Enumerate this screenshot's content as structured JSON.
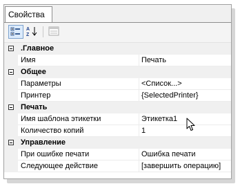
{
  "panel": {
    "tab_label": "Свойства",
    "toolbar": {
      "categorized_icon": "categorized-view-icon",
      "alphabetical_icon": "alphabetical-sort-icon",
      "property_pages_icon": "property-pages-icon"
    },
    "categories": [
      {
        "label": ".Главное",
        "properties": [
          {
            "name": "Имя",
            "value": "Печать"
          }
        ]
      },
      {
        "label": "Общее",
        "properties": [
          {
            "name": "Параметры",
            "value": "<Список...>"
          },
          {
            "name": "Принтер",
            "value": "{SelectedPrinter}"
          }
        ]
      },
      {
        "label": "Печать",
        "properties": [
          {
            "name": "Имя шаблона этикетки",
            "value": "Этикетка1"
          },
          {
            "name": "Количество копий",
            "value": "1"
          }
        ]
      },
      {
        "label": "Управление",
        "properties": [
          {
            "name": "При ошибке печати",
            "value": "Ошибка печати"
          },
          {
            "name": "Следующее действие",
            "value": "[завершить операцию]"
          }
        ]
      }
    ]
  },
  "colors": {
    "category_bg": "#f0f0f0",
    "active_button_bg": "#dcebfc",
    "active_button_border": "#7da2ce"
  }
}
